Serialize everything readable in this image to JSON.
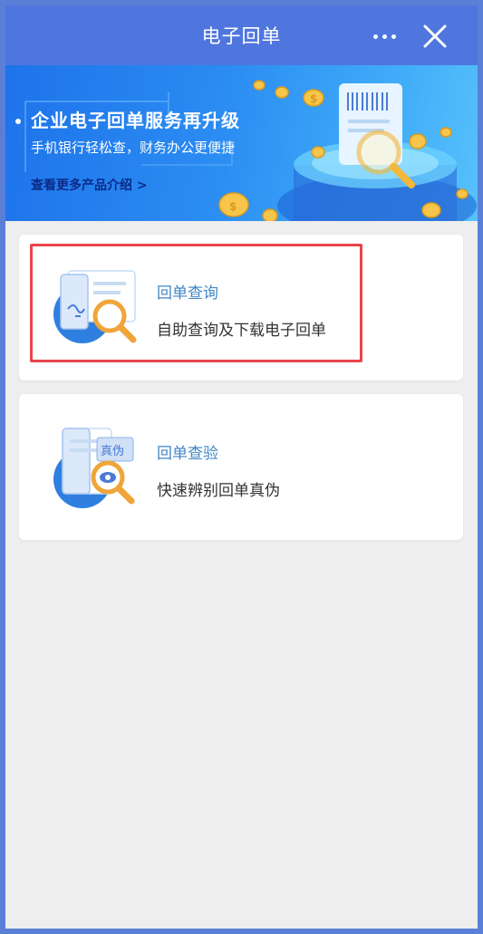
{
  "header": {
    "title": "电子回单",
    "more_icon": "more-horizontal-icon",
    "close_icon": "close-icon"
  },
  "banner": {
    "title": "企业电子回单服务再升级",
    "subtitle": "手机银行轻松查，财务办公更便捷",
    "link": "查看更多产品介绍 >"
  },
  "cards": [
    {
      "title": "回单查询",
      "description": "自助查询及下载电子回单",
      "icon": "document-search-icon"
    },
    {
      "title": "回单查验",
      "description": "快速辨别回单真伪",
      "icon": "document-verify-icon",
      "icon_tag": "真伪"
    }
  ],
  "colors": {
    "header_bg": "#4f76df",
    "frame_border": "#5a7fd6",
    "card_title": "#3f86c8",
    "highlight": "#e8454b",
    "page_bg": "#eeeeee"
  }
}
